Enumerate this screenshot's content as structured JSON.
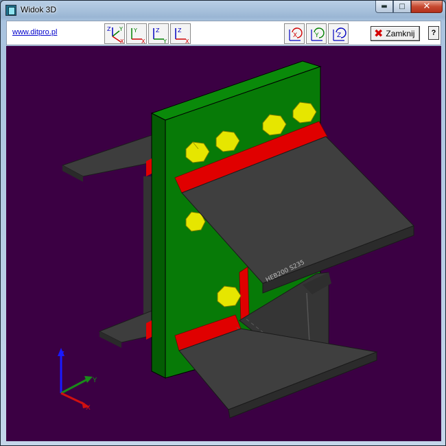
{
  "window": {
    "title": "Widok 3D",
    "caption": {
      "minimize": "▬",
      "maximize": "□",
      "close": "✕"
    }
  },
  "toolbar": {
    "link": "www.ditpro.pl",
    "view_buttons": [
      {
        "name": "view-xyz-isometric-button",
        "icon": "axes-zyx-icon"
      },
      {
        "name": "view-xy-button",
        "icon": "axes-yx-icon"
      },
      {
        "name": "view-zy-button",
        "icon": "axes-zy-icon"
      },
      {
        "name": "view-zx-button",
        "icon": "axes-zx-icon"
      }
    ],
    "rotate_buttons": [
      {
        "name": "rotate-x-button",
        "icon": "rotate-x-icon",
        "axis": "X"
      },
      {
        "name": "rotate-y-button",
        "icon": "rotate-y-icon",
        "axis": "Y"
      },
      {
        "name": "rotate-z-button",
        "icon": "rotate-z-icon",
        "axis": "Z"
      }
    ],
    "close_label": "Zamknij",
    "help_label": "?"
  },
  "scene": {
    "beam_label": "HEB200 S235",
    "axes": {
      "x": "X",
      "y": "Y",
      "z": "Z"
    },
    "colors": {
      "background": "#3b0043",
      "plate": "#0a7a0a",
      "beam": "#3a3a3a",
      "weld": "#e00000",
      "bolt": "#e6e600"
    }
  }
}
